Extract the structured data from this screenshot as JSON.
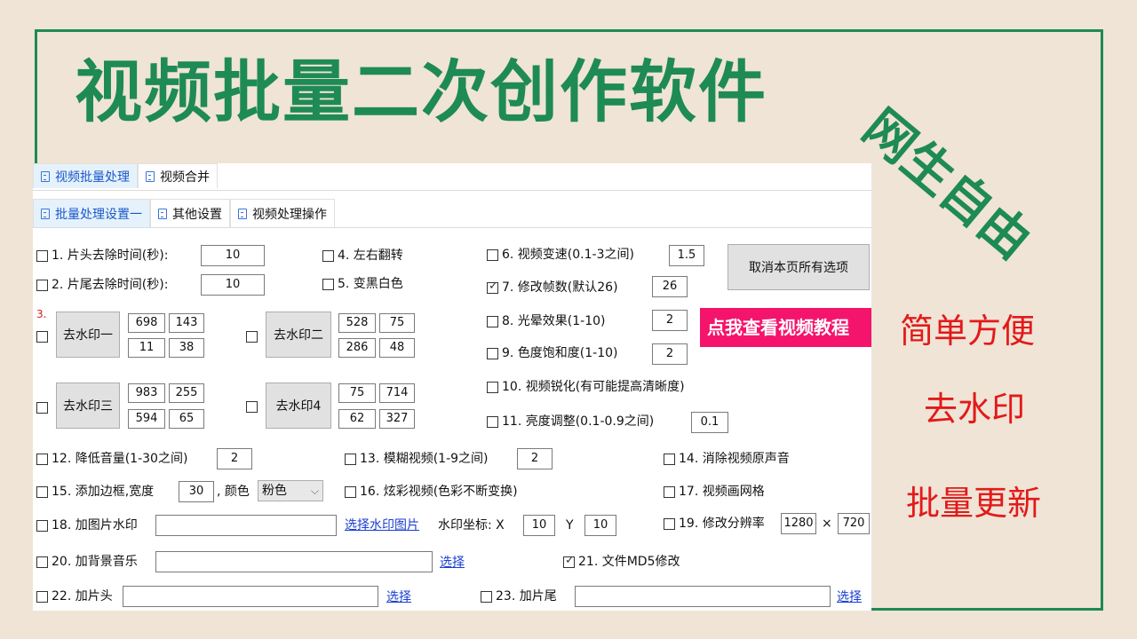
{
  "banner": {
    "title": "视频批量二次创作软件",
    "stamp": "网生自由",
    "side_1": "简单方便",
    "side_2": "去水印",
    "side_3": "批量更新"
  },
  "app": {
    "tabs_top": [
      "视频批量处理",
      "视频合并"
    ],
    "tabs_sub": [
      "批量处理设置一",
      "其他设置",
      "视频处理操作"
    ],
    "opt1": {
      "label": "1. 片头去除时间(秒):",
      "value": "10"
    },
    "opt2": {
      "label": "2. 片尾去除时间(秒):",
      "value": "10"
    },
    "opt4": {
      "label": "4. 左右翻转"
    },
    "opt5": {
      "label": "5. 变黑白色"
    },
    "opt6": {
      "label": "6. 视频变速(0.1-3之间)",
      "value": "1.5"
    },
    "opt7": {
      "label": "7. 修改帧数(默认26)",
      "value": "26"
    },
    "opt8": {
      "label": "8. 光晕效果(1-10)",
      "value": "2"
    },
    "opt9": {
      "label": "9. 色度饱和度(1-10)",
      "value": "2"
    },
    "opt10": {
      "label": "10. 视频锐化(有可能提高清晰度)"
    },
    "opt11": {
      "label": "11. 亮度调整(0.1-0.9之间)",
      "value": "0.1"
    },
    "opt12": {
      "label": "12. 降低音量(1-30之间)",
      "value": "2"
    },
    "opt13": {
      "label": "13. 模糊视频(1-9之间)",
      "value": "2"
    },
    "opt14": {
      "label": "14. 消除视频原声音"
    },
    "opt15": {
      "label": "15. 添加边框,宽度",
      "value": "30",
      "color_label": ", 颜色",
      "color_value": "粉色"
    },
    "opt16": {
      "label": "16. 炫彩视频(色彩不断变换)"
    },
    "opt17": {
      "label": "17. 视频画网格"
    },
    "opt18": {
      "label": "18. 加图片水印",
      "link": "选择水印图片",
      "coord_label": "水印坐标: X",
      "x": "10",
      "y_label": "Y",
      "y": "10"
    },
    "opt19": {
      "label": "19. 修改分辨率",
      "w": "1280",
      "times": "×",
      "h": "720"
    },
    "opt20": {
      "label": "20. 加背景音乐",
      "link": "选择"
    },
    "opt21": {
      "label": "21. 文件MD5修改"
    },
    "opt22": {
      "label": "22. 加片头",
      "link": "选择"
    },
    "opt23": {
      "label": "23. 加片尾",
      "link": "选择"
    },
    "clear_button": "取消本页所有选项",
    "tutorial_button": "点我查看视频教程",
    "marker": "3.",
    "wm1": {
      "label": "去水印一",
      "vals": [
        "698",
        "143",
        "11",
        "38"
      ]
    },
    "wm2": {
      "label": "去水印二",
      "vals": [
        "528",
        "75",
        "286",
        "48"
      ]
    },
    "wm3": {
      "label": "去水印三",
      "vals": [
        "983",
        "255",
        "594",
        "65"
      ]
    },
    "wm4": {
      "label": "去水印4",
      "vals": [
        "75",
        "714",
        "62",
        "327"
      ]
    }
  }
}
